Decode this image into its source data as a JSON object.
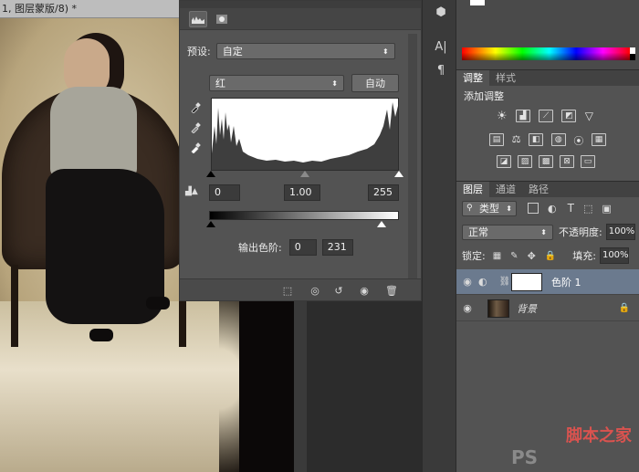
{
  "document": {
    "tab_title": "1, 图层蒙版/8) *"
  },
  "properties": {
    "preset_label": "预设:",
    "preset_value": "自定",
    "channel_value": "红",
    "auto_button": "自动",
    "input_black": "0",
    "input_gamma": "1.00",
    "input_white": "255",
    "output_label": "输出色阶:",
    "output_black": "0",
    "output_white": "231"
  },
  "adjustments": {
    "tab_adjust": "调整",
    "tab_style": "样式",
    "add_label": "添加调整"
  },
  "layers": {
    "tab_layers": "图层",
    "tab_channels": "通道",
    "tab_paths": "路径",
    "filter_type": "类型",
    "blend_mode": "正常",
    "opacity_label": "不透明度:",
    "opacity_value": "100%",
    "lock_label": "锁定:",
    "fill_label": "填充:",
    "fill_value": "100%",
    "items": [
      {
        "name": "色阶 1"
      },
      {
        "name": "背景"
      }
    ]
  },
  "icons": {
    "eyedroppers": [
      "eyedropper-black-icon",
      "eyedropper-gray-icon",
      "eyedropper-white-icon"
    ],
    "footer": [
      "clip-to-layer-icon",
      "view-previous-icon",
      "reset-icon",
      "visibility-icon",
      "delete-icon"
    ]
  },
  "colors": {
    "panel": "#535353",
    "selected_layer": "#6b7a8e"
  },
  "watermark": {
    "line1": "脚本之家",
    "line2": "PS"
  }
}
